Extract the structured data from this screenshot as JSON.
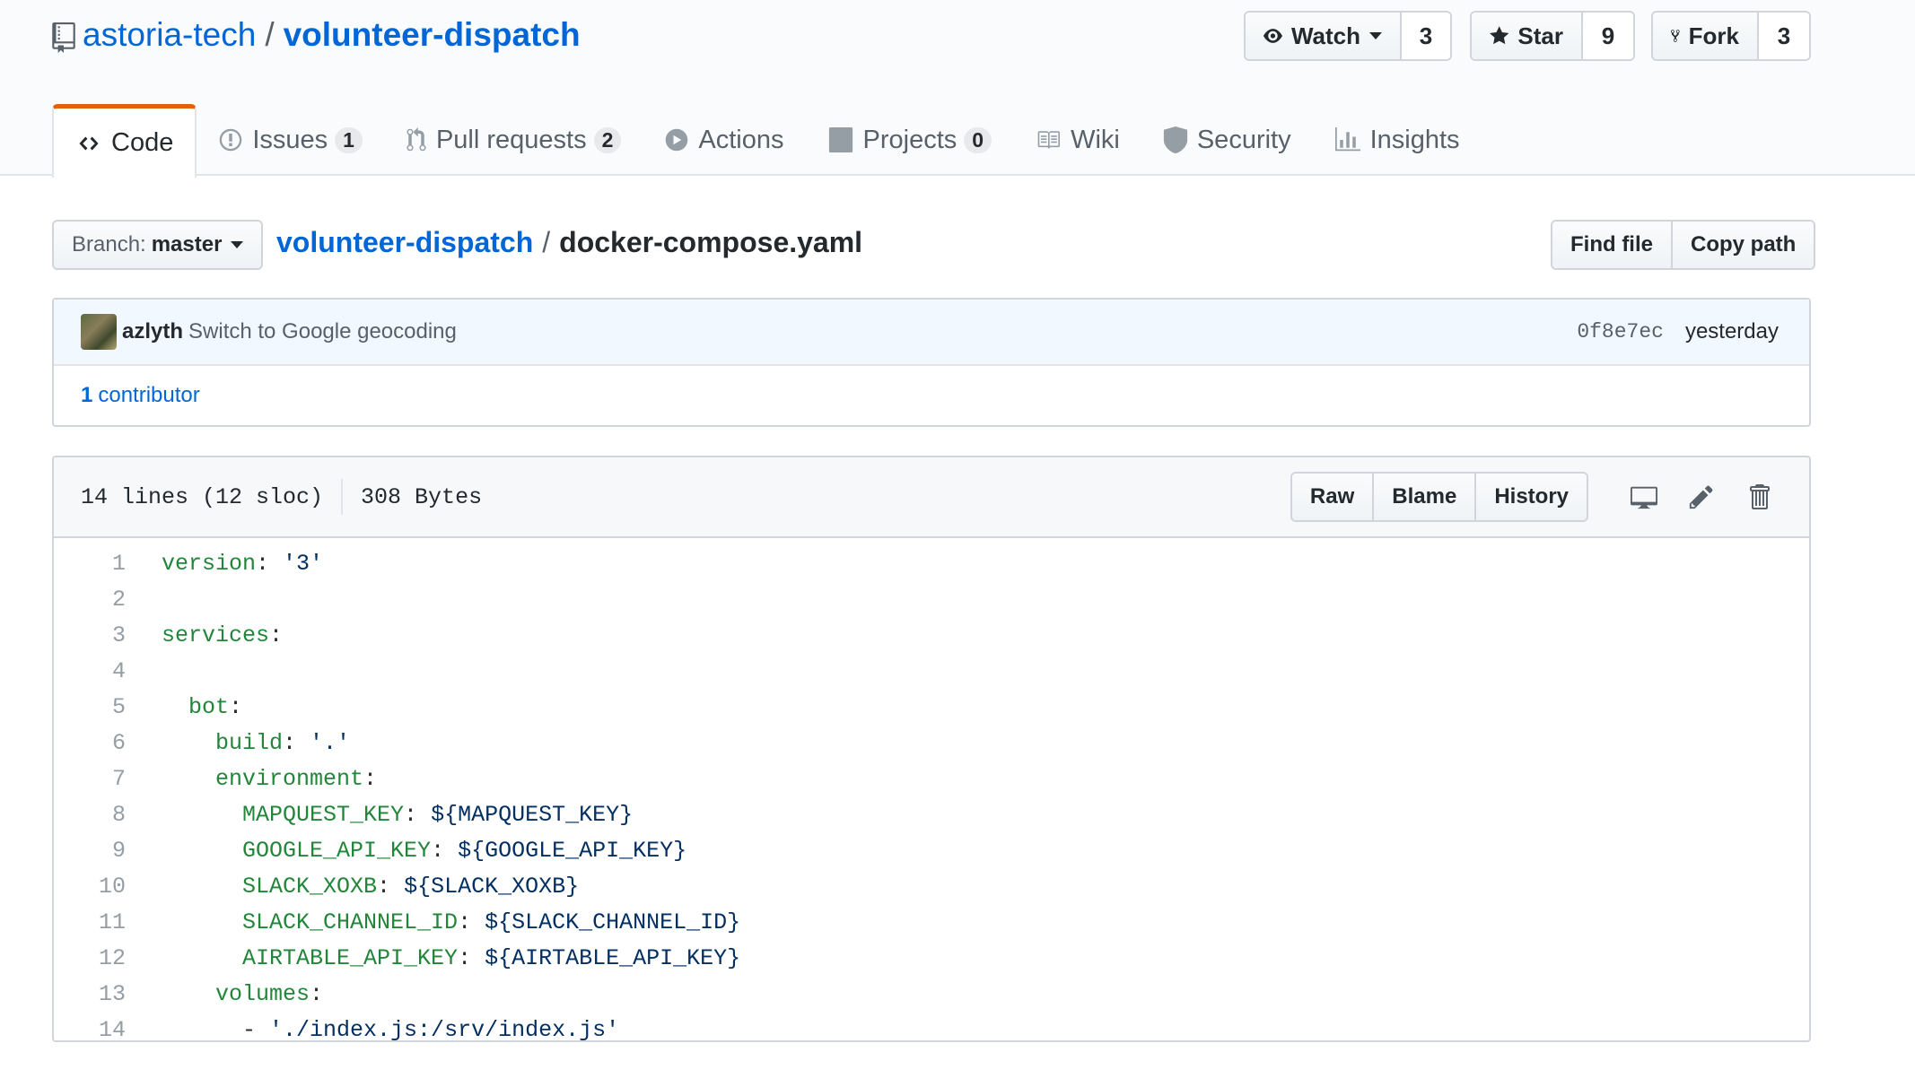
{
  "repo": {
    "owner": "astoria-tech",
    "separator": "/",
    "name": "volunteer-dispatch"
  },
  "header_actions": {
    "watch": {
      "label": "Watch",
      "count": "3"
    },
    "star": {
      "label": "Star",
      "count": "9"
    },
    "fork": {
      "label": "Fork",
      "count": "3"
    }
  },
  "tabs": [
    {
      "label": "Code",
      "icon": "code-icon",
      "selected": true
    },
    {
      "label": "Issues",
      "icon": "issue-icon",
      "counter": "1"
    },
    {
      "label": "Pull requests",
      "icon": "pull-request-icon",
      "counter": "2"
    },
    {
      "label": "Actions",
      "icon": "play-icon"
    },
    {
      "label": "Projects",
      "icon": "project-icon",
      "counter": "0"
    },
    {
      "label": "Wiki",
      "icon": "book-icon"
    },
    {
      "label": "Security",
      "icon": "shield-icon"
    },
    {
      "label": "Insights",
      "icon": "graph-icon"
    }
  ],
  "branch": {
    "label": "Branch:",
    "value": "master"
  },
  "breadcrumb": {
    "repo": "volunteer-dispatch",
    "separator": "/",
    "file": "docker-compose.yaml"
  },
  "file_nav": {
    "find_file": "Find file",
    "copy_path": "Copy path"
  },
  "commit": {
    "author": "azlyth",
    "message": "Switch to Google geocoding",
    "sha": "0f8e7ec",
    "time": "yesterday",
    "contributors_count": "1",
    "contributors_label": "contributor"
  },
  "file": {
    "lines_info": "14 lines (12 sloc)",
    "size": "308 Bytes",
    "buttons": {
      "raw": "Raw",
      "blame": "Blame",
      "history": "History"
    }
  },
  "code_lines": [
    {
      "n": "1",
      "indent": "",
      "key": "version",
      "sep": ": ",
      "val": "'3'"
    },
    {
      "n": "2",
      "indent": "",
      "key": "",
      "sep": "",
      "val": ""
    },
    {
      "n": "3",
      "indent": "",
      "key": "services",
      "sep": ":",
      "val": ""
    },
    {
      "n": "4",
      "indent": "",
      "key": "",
      "sep": "",
      "val": ""
    },
    {
      "n": "5",
      "indent": "  ",
      "key": "bot",
      "sep": ":",
      "val": ""
    },
    {
      "n": "6",
      "indent": "    ",
      "key": "build",
      "sep": ": ",
      "val": "'.'"
    },
    {
      "n": "7",
      "indent": "    ",
      "key": "environment",
      "sep": ":",
      "val": ""
    },
    {
      "n": "8",
      "indent": "      ",
      "key": "MAPQUEST_KEY",
      "sep": ": ",
      "val": "${MAPQUEST_KEY}"
    },
    {
      "n": "9",
      "indent": "      ",
      "key": "GOOGLE_API_KEY",
      "sep": ": ",
      "val": "${GOOGLE_API_KEY}"
    },
    {
      "n": "10",
      "indent": "      ",
      "key": "SLACK_XOXB",
      "sep": ": ",
      "val": "${SLACK_XOXB}"
    },
    {
      "n": "11",
      "indent": "      ",
      "key": "SLACK_CHANNEL_ID",
      "sep": ": ",
      "val": "${SLACK_CHANNEL_ID}"
    },
    {
      "n": "12",
      "indent": "      ",
      "key": "AIRTABLE_API_KEY",
      "sep": ": ",
      "val": "${AIRTABLE_API_KEY}"
    },
    {
      "n": "13",
      "indent": "    ",
      "key": "volumes",
      "sep": ":",
      "val": ""
    },
    {
      "n": "14",
      "indent": "      - ",
      "key": "",
      "sep": "",
      "val": "'./index.js:/srv/index.js'"
    }
  ],
  "colors": {
    "link": "#0366d6",
    "tab_accent": "#e36209",
    "yaml_key": "#22863a",
    "yaml_string": "#032f62"
  }
}
